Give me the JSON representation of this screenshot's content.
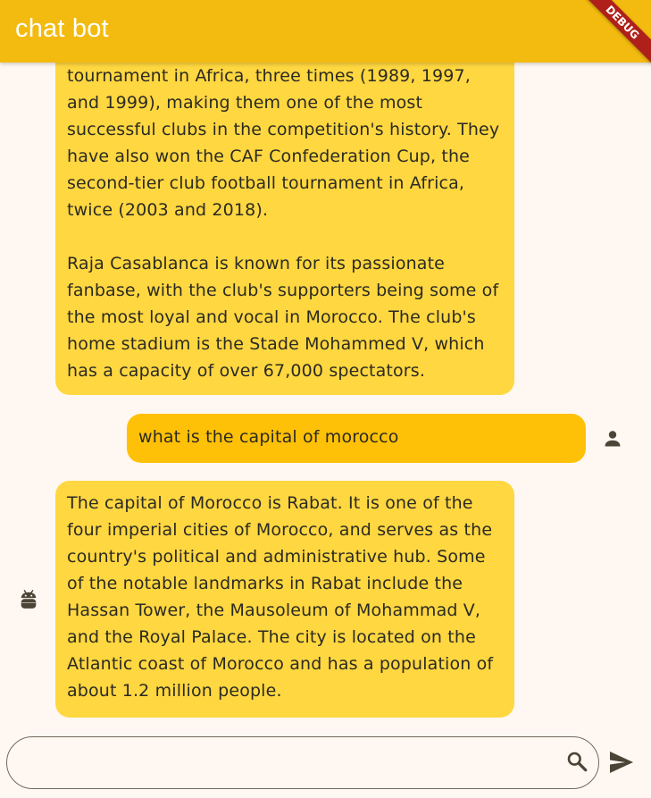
{
  "app_bar": {
    "title": "chat bot",
    "background": "#f3bb0f",
    "debug_label": "DEBUG",
    "debug_color": "#b0201a"
  },
  "messages": [
    {
      "sender": "bot",
      "text": "tournament in Africa, three times (1989, 1997, and 1999), making them one of the most successful clubs in the competition's history. They have also won the CAF Confederation Cup, the second-tier club football tournament in Africa, twice (2003 and 2018).\n\nRaja Casablanca is known for its passionate fanbase, with the club's supporters being some of the most loyal and vocal in Morocco. The club's home stadium is the Stade Mohammed V, which has a capacity of over 67,000 spectators.",
      "color": "#ffd740"
    },
    {
      "sender": "user",
      "text": "what is the capital of morocco",
      "color": "#ffc107",
      "avatar_icon": "person-icon"
    },
    {
      "sender": "bot",
      "text": "The capital of Morocco is Rabat. It is one of the four imperial cities of Morocco, and serves as the country's political and administrative hub. Some of the notable landmarks in Rabat include the Hassan Tower, the Mausoleum of Mohammad V, and the Royal Palace. The city is located on the Atlantic coast of Morocco and has a population of about 1.2 million people.",
      "color": "#ffd740",
      "avatar_icon": "android-icon"
    }
  ],
  "input": {
    "value": "",
    "placeholder": "",
    "search_icon": "search-icon",
    "send_icon": "send-icon"
  }
}
